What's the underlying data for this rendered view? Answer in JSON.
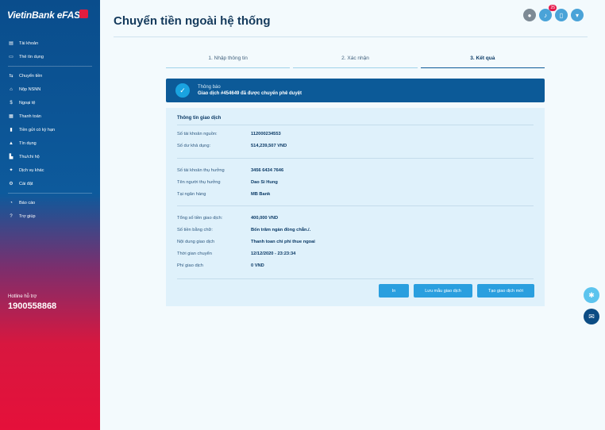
{
  "sidebar": {
    "logo": "VietinBank eFAST",
    "items": [
      {
        "label": "Tài khoản",
        "icon": "account-icon"
      },
      {
        "label": "Thẻ tín dụng",
        "icon": "card-icon"
      },
      {
        "label": "Chuyển tiền",
        "icon": "transfer-icon"
      },
      {
        "label": "Nộp NSNN",
        "icon": "tax-icon"
      },
      {
        "label": "Ngoại tệ",
        "icon": "currency-icon"
      },
      {
        "label": "Thanh toán",
        "icon": "payment-icon"
      },
      {
        "label": "Tiền gửi có kỳ hạn",
        "icon": "deposit-icon"
      },
      {
        "label": "Tín dụng",
        "icon": "credit-icon"
      },
      {
        "label": "Thu/chi hộ",
        "icon": "collection-icon"
      },
      {
        "label": "Dịch vụ khác",
        "icon": "services-icon"
      },
      {
        "label": "Cài đặt",
        "icon": "settings-icon"
      },
      {
        "label": "Báo cáo",
        "icon": "report-icon"
      },
      {
        "label": "Trợ giúp",
        "icon": "help-icon"
      }
    ],
    "hotline_label": "Hotline hỗ trợ",
    "hotline_number": "1900558868"
  },
  "header": {
    "title": "Chuyển tiền ngoài hệ thống",
    "notification_count": "25"
  },
  "steps": [
    "1. Nhập thông tin",
    "2. Xác nhận",
    "3. Kết quả"
  ],
  "notice": {
    "title": "Thông báo",
    "message": "Giao dịch #454649 đã được chuyển phê duyệt"
  },
  "card": {
    "title": "Thông tin giao dịch",
    "groups": [
      [
        {
          "label": "Số tài khoản nguồn:",
          "value": "112000234553"
        },
        {
          "label": "Số dư khả dụng:",
          "value": "514,239,507 VND"
        }
      ],
      [
        {
          "label": "Số tài khoản thụ hưởng",
          "value": "3456 6434 7646"
        },
        {
          "label": "Tên người thụ hưởng",
          "value": "Dao Si Hung"
        },
        {
          "label": "Tại ngân hàng",
          "value": "MB Bank"
        }
      ],
      [
        {
          "label": "Tổng số tiền giao dịch:",
          "value": "400,000 VND"
        },
        {
          "label": "Số tiền bằng chữ:",
          "value": "Bốn trăm ngàn đồng chẵn./."
        },
        {
          "label": "Nội dung giao dịch",
          "value": "Thanh toan chi phi thue ngoai"
        },
        {
          "label": "Thời gian chuyển",
          "value": "12/12/2020 - 23:23:34"
        },
        {
          "label": "Phí giao dịch",
          "value": "0 VND"
        }
      ]
    ],
    "buttons": {
      "print": "In",
      "save_template": "Lưu mẫu giao dịch",
      "new_transaction": "Tạo giao dịch mới"
    }
  },
  "colors": {
    "primary": "#0c5a98",
    "accent": "#2a9fdf",
    "brand_red": "#e5103a"
  }
}
